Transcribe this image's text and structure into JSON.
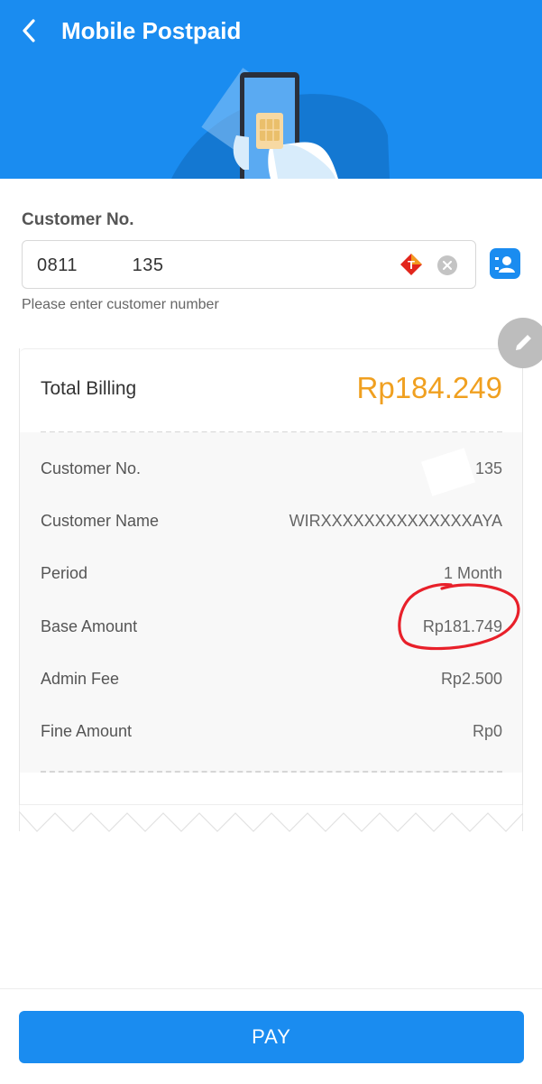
{
  "header": {
    "title": "Mobile Postpaid"
  },
  "customer": {
    "label": "Customer No.",
    "input_value": "0811          135",
    "helper": "Please enter customer number",
    "operator_letter": "T"
  },
  "billing": {
    "total_label": "Total Billing",
    "total_value": "Rp184.249",
    "rows": [
      {
        "label": "Customer No.",
        "value": "0811          135"
      },
      {
        "label": "Customer Name",
        "value": "WIRXXXXXXXXXXXXXXAYA"
      },
      {
        "label": "Period",
        "value": "1 Month"
      },
      {
        "label": "Base Amount",
        "value": "Rp181.749"
      },
      {
        "label": "Admin Fee",
        "value": "Rp2.500"
      },
      {
        "label": "Fine Amount",
        "value": "Rp0"
      }
    ]
  },
  "footer": {
    "pay_label": "PAY"
  },
  "colors": {
    "primary": "#1a8cf0",
    "total": "#f0a020",
    "annotation": "#e8202a"
  }
}
